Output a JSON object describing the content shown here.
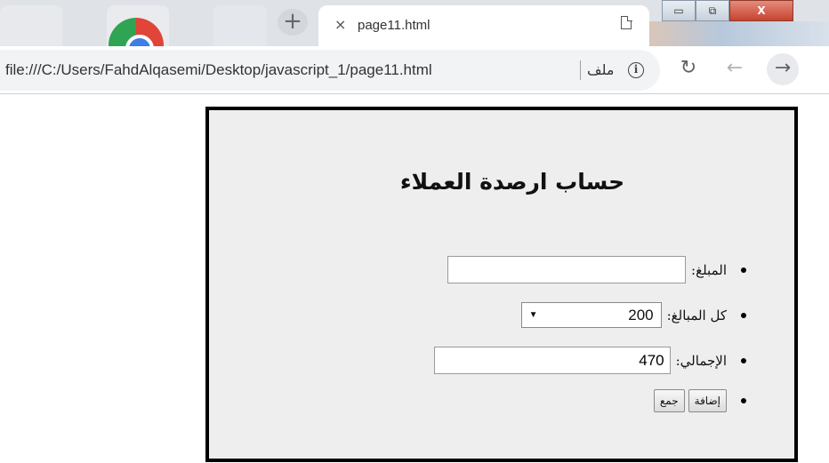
{
  "browser": {
    "tab_title": "page11.html",
    "tab_close_icon": "×",
    "new_tab_icon": "+",
    "url": "file:///C:/Users/FahdAlqasemi/Desktop/javascript_1/page11.html",
    "file_label": "ملف",
    "info_icon": "i",
    "reload_icon": "↻",
    "back_icon": "←",
    "forward_icon": "→",
    "window_controls": {
      "minimize": "▭",
      "maximize": "⧉",
      "close": "X"
    }
  },
  "page": {
    "heading": "حساب ارصدة العملاء",
    "amount": {
      "label": "المبلغ:",
      "value": ""
    },
    "all_amounts": {
      "label": "كل المبالغ:",
      "selected": "200",
      "arrow": "▼"
    },
    "total": {
      "label": "الإجمالي:",
      "value": "470"
    },
    "buttons": {
      "add": "إضافة",
      "sum": "جمع"
    }
  }
}
